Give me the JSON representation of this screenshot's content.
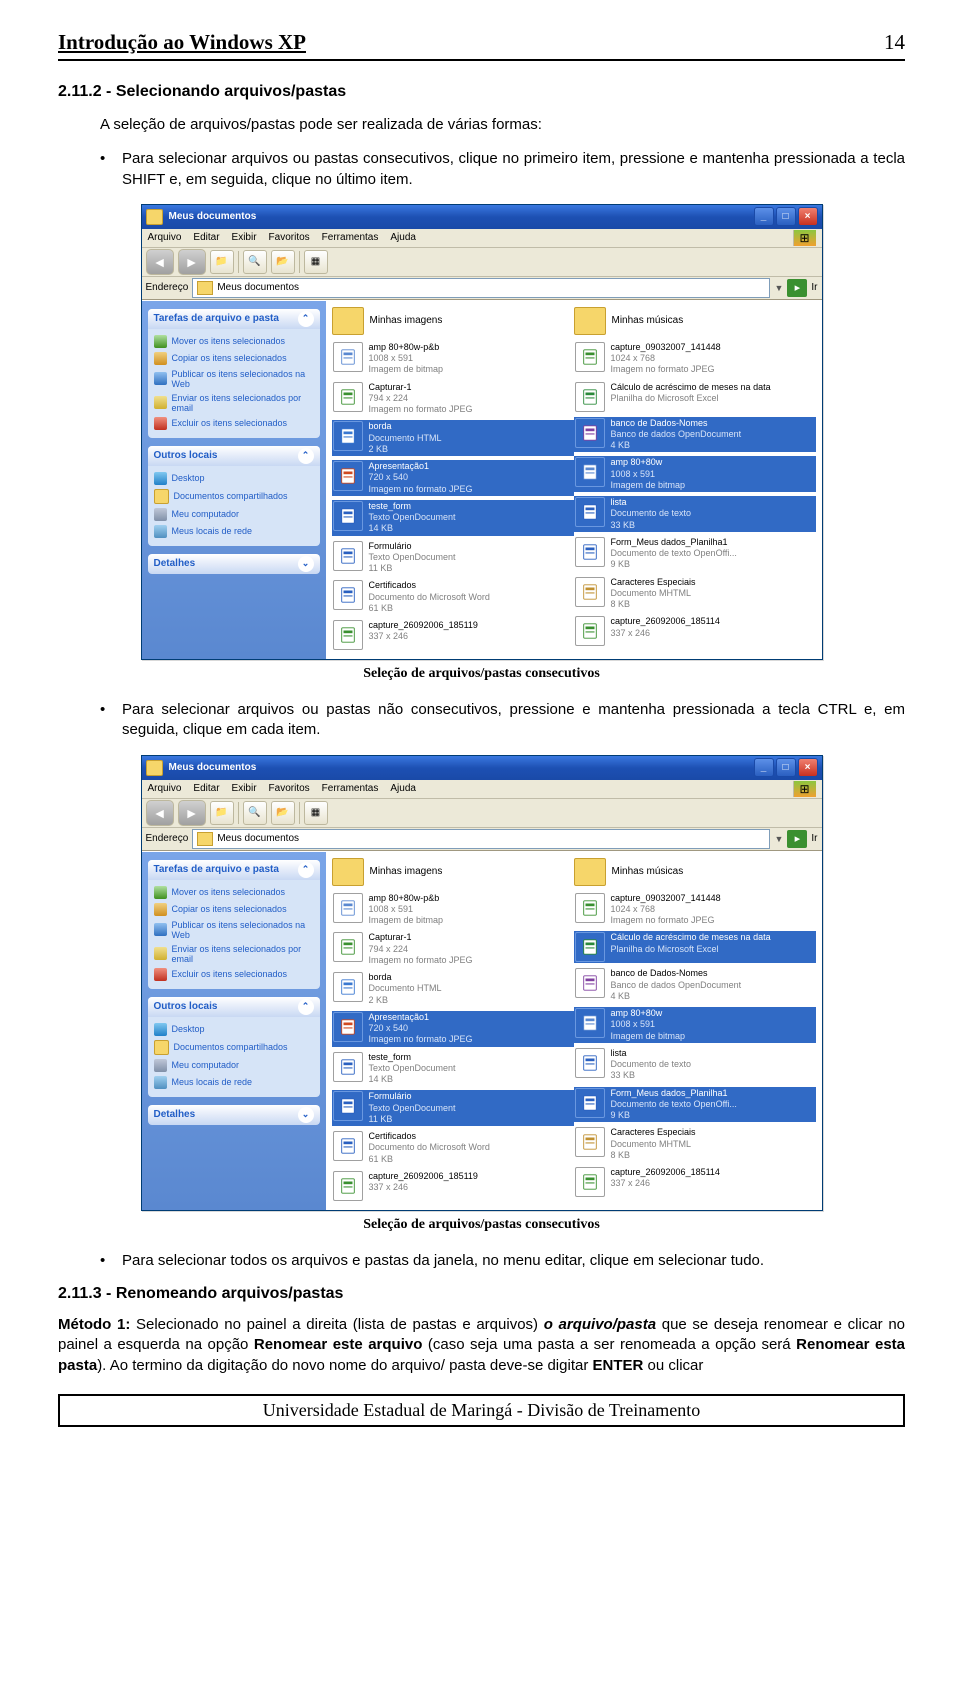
{
  "header": {
    "title": "Introdução ao Windows XP",
    "page": "14"
  },
  "section": {
    "title": "2.11.2 - Selecionando arquivos/pastas",
    "intro": "A seleção de arquivos/pastas pode ser realizada de várias formas:",
    "bullet1": "Para selecionar arquivos ou pastas consecutivos, clique no primeiro item, pressione e mantenha pressionada a tecla SHIFT e, em seguida, clique no último item.",
    "caption1": "Seleção de arquivos/pastas consecutivos",
    "bullet2": "Para selecionar arquivos ou pastas não consecutivos, pressione e mantenha pressionada a tecla CTRL e, em seguida, clique em cada item.",
    "caption2": "Seleção de arquivos/pastas consecutivos",
    "bullet3": "Para selecionar todos os arquivos e pastas da janela, no menu editar, clique em selecionar tudo."
  },
  "section2": {
    "title": "2.11.3 - Renomeando arquivos/pastas",
    "m1label": "Método 1:",
    "m1a": "Selecionado no painel a direita (lista de pastas e arquivos)",
    "m1b": "o arquivo/pasta",
    "m1c": "que se deseja renomear e clicar no painel a esquerda na opção",
    "m1d": "Renomear este arquivo",
    "m1e": "(caso seja uma pasta a ser renomeada a opção será",
    "m1f": "Renomear esta pasta",
    "m1g": "). Ao termino da digitação do novo nome do arquivo/ pasta deve-se digitar",
    "m1h": "ENTER",
    "m1i": "ou clicar"
  },
  "win": {
    "title": "Meus documentos",
    "menu": [
      "Arquivo",
      "Editar",
      "Exibir",
      "Favoritos",
      "Ferramentas",
      "Ajuda"
    ],
    "addressLabel": "Endereço",
    "addressValue": "Meus documentos",
    "go": "Ir"
  },
  "side": {
    "tasksTitle": "Tarefas de arquivo e pasta",
    "tasks": [
      "Mover os itens selecionados",
      "Copiar os itens selecionados",
      "Publicar os itens selecionados na Web",
      "Enviar os itens selecionados por email",
      "Excluir os itens selecionados"
    ],
    "placesTitle": "Outros locais",
    "places": [
      "Desktop",
      "Documentos compartilhados",
      "Meu computador",
      "Meus locais de rede"
    ],
    "detailsTitle": "Detalhes"
  },
  "folders": [
    "Minhas imagens",
    "Minhas músicas"
  ],
  "iconColors": {
    "img": "#5a88d0",
    "jpg": "#3a9030",
    "xls": "#2a8a3a",
    "ie": "#3a78d0",
    "odp": "#d04a20",
    "odt": "#2a60c0",
    "doc": "#2a60c0",
    "odb": "#8040a0",
    "mht": "#c09030",
    "ods": "#2a8a3a"
  },
  "files1": {
    "left": [
      {
        "n": "amp 80+80w-p&b",
        "l2": "1008 x 591",
        "l3": "Imagem de bitmap",
        "ic": "img"
      },
      {
        "n": "Capturar-1",
        "l2": "794 x 224",
        "l3": "Imagem no formato JPEG",
        "ic": "jpg"
      },
      {
        "n": "borda",
        "l2": "Documento HTML",
        "l3": "2 KB",
        "ic": "ie",
        "sel": true
      },
      {
        "n": "Apresentação1",
        "l2": "720 x 540",
        "l3": "Imagem no formato JPEG",
        "ic": "odp",
        "sel": true
      },
      {
        "n": "teste_form",
        "l2": "Texto OpenDocument",
        "l3": "14 KB",
        "ic": "odt",
        "sel": true
      },
      {
        "n": "Formulário",
        "l2": "Texto OpenDocument",
        "l3": "11 KB",
        "ic": "odt"
      },
      {
        "n": "Certificados",
        "l2": "Documento do Microsoft Word",
        "l3": "61 KB",
        "ic": "doc"
      },
      {
        "n": "capture_26092006_185119",
        "l2": "337 x 246",
        "l3": "",
        "ic": "jpg"
      }
    ],
    "right": [
      {
        "n": "capture_09032007_141448",
        "l2": "1024 x 768",
        "l3": "Imagem no formato JPEG",
        "ic": "jpg"
      },
      {
        "n": "Cálculo de acréscimo de meses na data",
        "l2": "Planilha do Microsoft Excel",
        "l3": "",
        "ic": "xls"
      },
      {
        "n": "banco de Dados-Nomes",
        "l2": "Banco de dados OpenDocument",
        "l3": "4 KB",
        "ic": "odb",
        "sel": true
      },
      {
        "n": "amp 80+80w",
        "l2": "1008 x 591",
        "l3": "Imagem de bitmap",
        "ic": "img",
        "sel": true
      },
      {
        "n": "lista",
        "l2": "Documento de texto",
        "l3": "33 KB",
        "ic": "odt",
        "sel": true
      },
      {
        "n": "Form_Meus dados_Planilha1",
        "l2": "Documento de texto OpenOffi...",
        "l3": "9 KB",
        "ic": "odt"
      },
      {
        "n": "Caracteres Especiais",
        "l2": "Documento MHTML",
        "l3": "8 KB",
        "ic": "mht"
      },
      {
        "n": "capture_26092006_185114",
        "l2": "337 x 246",
        "l3": "",
        "ic": "jpg"
      }
    ]
  },
  "files2": {
    "left": [
      {
        "n": "amp 80+80w-p&b",
        "l2": "1008 x 591",
        "l3": "Imagem de bitmap",
        "ic": "img"
      },
      {
        "n": "Capturar-1",
        "l2": "794 x 224",
        "l3": "Imagem no formato JPEG",
        "ic": "jpg"
      },
      {
        "n": "borda",
        "l2": "Documento HTML",
        "l3": "2 KB",
        "ic": "ie"
      },
      {
        "n": "Apresentação1",
        "l2": "720 x 540",
        "l3": "Imagem no formato JPEG",
        "ic": "odp",
        "sel": true
      },
      {
        "n": "teste_form",
        "l2": "Texto OpenDocument",
        "l3": "14 KB",
        "ic": "odt"
      },
      {
        "n": "Formulário",
        "l2": "Texto OpenDocument",
        "l3": "11 KB",
        "ic": "odt",
        "sel": true
      },
      {
        "n": "Certificados",
        "l2": "Documento do Microsoft Word",
        "l3": "61 KB",
        "ic": "doc"
      },
      {
        "n": "capture_26092006_185119",
        "l2": "337 x 246",
        "l3": "",
        "ic": "jpg"
      }
    ],
    "right": [
      {
        "n": "capture_09032007_141448",
        "l2": "1024 x 768",
        "l3": "Imagem no formato JPEG",
        "ic": "jpg"
      },
      {
        "n": "Cálculo de acréscimo de meses na data",
        "l2": "Planilha do Microsoft Excel",
        "l3": "",
        "ic": "xls",
        "sel": true
      },
      {
        "n": "banco de Dados-Nomes",
        "l2": "Banco de dados OpenDocument",
        "l3": "4 KB",
        "ic": "odb"
      },
      {
        "n": "amp 80+80w",
        "l2": "1008 x 591",
        "l3": "Imagem de bitmap",
        "ic": "img",
        "sel": true
      },
      {
        "n": "lista",
        "l2": "Documento de texto",
        "l3": "33 KB",
        "ic": "odt"
      },
      {
        "n": "Form_Meus dados_Planilha1",
        "l2": "Documento de texto OpenOffi...",
        "l3": "9 KB",
        "ic": "odt",
        "sel": true
      },
      {
        "n": "Caracteres Especiais",
        "l2": "Documento MHTML",
        "l3": "8 KB",
        "ic": "mht"
      },
      {
        "n": "capture_26092006_185114",
        "l2": "337 x 246",
        "l3": "",
        "ic": "jpg"
      }
    ]
  },
  "footer": {
    "text": "Universidade Estadual de Maringá - Divisão de Treinamento"
  }
}
